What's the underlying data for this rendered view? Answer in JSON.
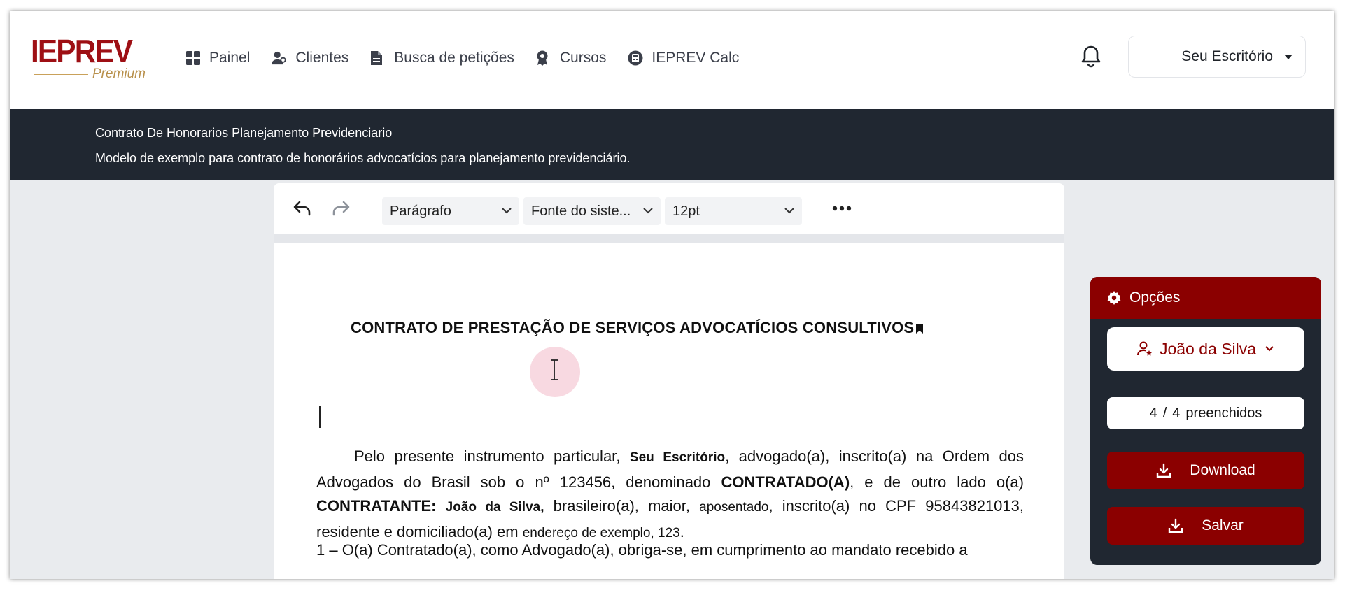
{
  "brand": {
    "logo_text": "IEPREV",
    "logo_sub": "Premium",
    "primary_color": "#8b0000",
    "gold_color": "#b8904b"
  },
  "nav": {
    "items": [
      {
        "label": "Painel",
        "icon": "grid-icon"
      },
      {
        "label": "Clientes",
        "icon": "users-icon"
      },
      {
        "label": "Busca de petições",
        "icon": "document-icon"
      },
      {
        "label": "Cursos",
        "icon": "award-icon"
      },
      {
        "label": "IEPREV Calc",
        "icon": "calculator-icon"
      }
    ],
    "office_label": "Seu Escritório"
  },
  "header": {
    "title": "Contrato De Honorarios Planejamento Previdenciario",
    "description": "Modelo de exemplo para contrato de honorários advocatícios para planejamento previdenciário."
  },
  "toolbar": {
    "block_format": "Parágrafo",
    "font_family": "Fonte do siste...",
    "font_size": "12pt"
  },
  "document": {
    "title": "CONTRATO DE PRESTAÇÃO DE SERVIÇOS ADVOCATÍCIOS CONSULTIVOS",
    "p1": {
      "a": "Pelo presente instrumento particular, ",
      "office": "Seu Escritório",
      "b": ", advogado(a), inscrito(a) na Ordem dos Advogados do Brasil sob o nº 123456, denominado ",
      "contratado": "CONTRATADO(A)",
      "c": ", e de outro lado o(a) ",
      "contratante": "CONTRATANTE:",
      "sp": " ",
      "client": "João da Silva,",
      "d": " brasileiro(a), maior, ",
      "profession": "aposentado",
      "e": ", inscrito(a) no CPF 95843821013, residente e domiciliado(a) em ",
      "address": "endereço de exemplo, 123",
      "f": "."
    },
    "p2": "1 – O(a) Contratado(a), como Advogado(a), obriga-se, em cumprimento ao mandato recebido a"
  },
  "options": {
    "title": "Opções",
    "client_name": "João da Silva",
    "filled_count": "4",
    "filled_sep": "/",
    "filled_total": "4",
    "filled_label": "preenchidos",
    "download_label": "Download",
    "save_label": "Salvar"
  }
}
